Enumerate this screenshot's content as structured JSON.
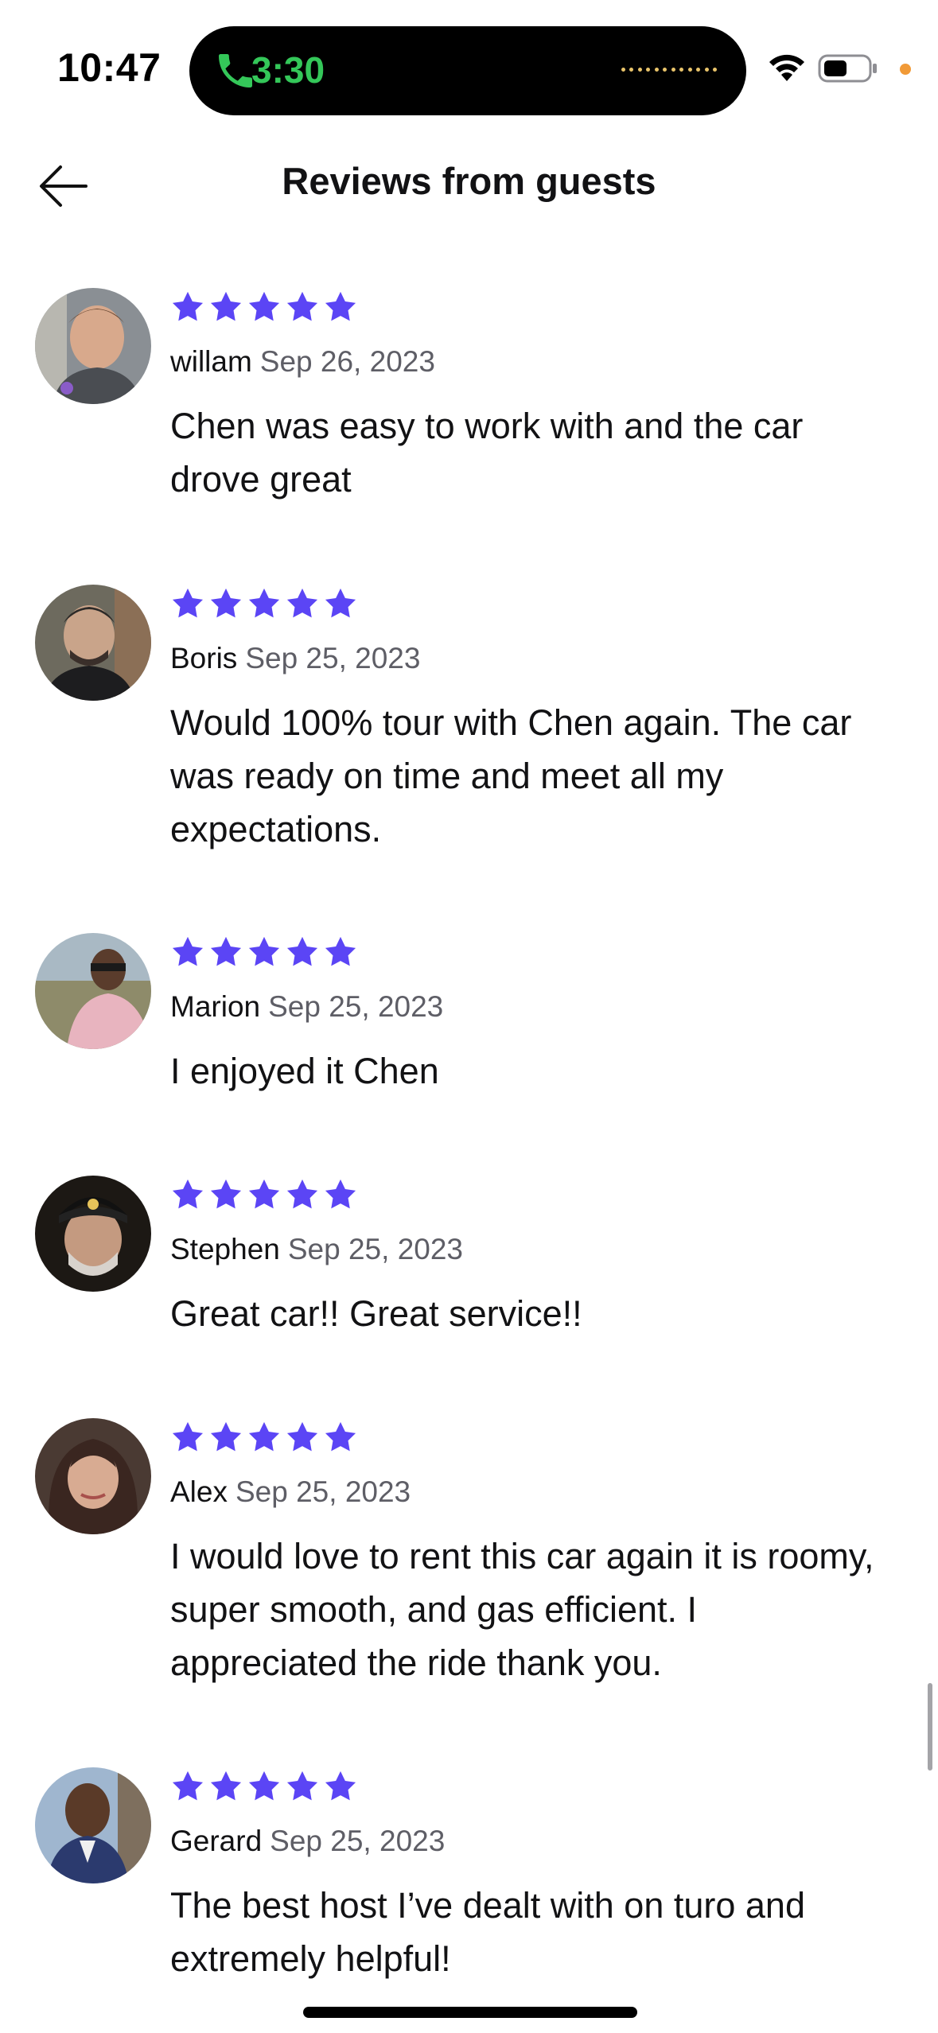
{
  "status_bar": {
    "time": "10:47",
    "call_duration": "3:30",
    "call_color": "#34c759",
    "indicator_dot_color": "#f19a37",
    "icons": [
      "phone-icon",
      "wifi-icon",
      "battery-icon"
    ]
  },
  "header": {
    "title": "Reviews from guests",
    "back_icon": "arrow-left-icon"
  },
  "accent_color": "#5b45f5",
  "reviews": [
    {
      "name": "willam",
      "date": "Sep 26, 2023",
      "rating": 5,
      "text": "Chen was easy to work with and the car drove great"
    },
    {
      "name": "Boris",
      "date": "Sep 25, 2023",
      "rating": 5,
      "text": "Would 100% tour with Chen again. The car was ready on time and meet all my expectations."
    },
    {
      "name": "Marion",
      "date": "Sep 25, 2023",
      "rating": 5,
      "text": "I enjoyed it Chen"
    },
    {
      "name": "Stephen",
      "date": "Sep 25, 2023",
      "rating": 5,
      "text": "Great car!! Great service!!"
    },
    {
      "name": "Alex",
      "date": "Sep 25, 2023",
      "rating": 5,
      "text": "I would love to rent this car again it is roomy, super smooth, and gas efficient. I appreciated the ride thank you."
    },
    {
      "name": "Gerard",
      "date": "Sep 25, 2023",
      "rating": 5,
      "text": "The best host I’ve dealt with on turo and extremely helpful!"
    }
  ]
}
